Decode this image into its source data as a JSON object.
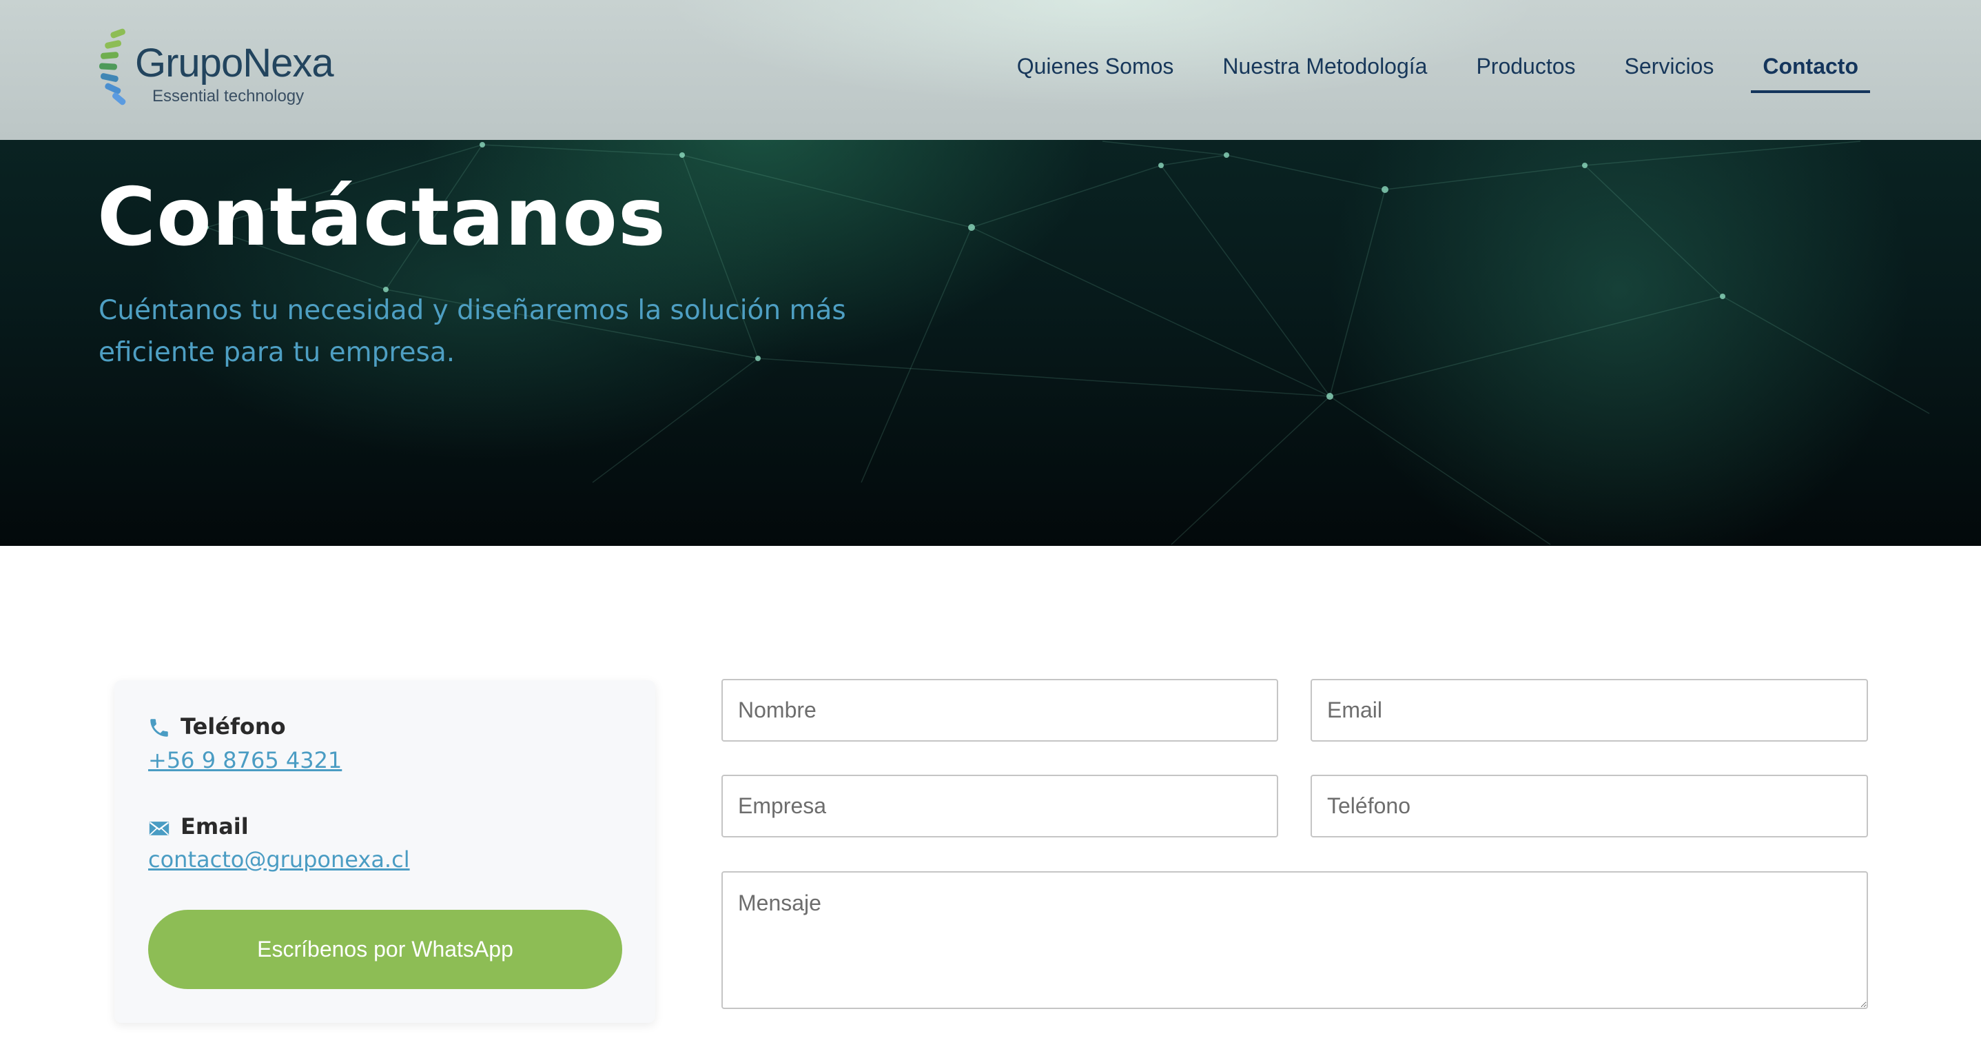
{
  "brand": {
    "name": "GrupoNexa",
    "tagline": "Essential technology"
  },
  "nav": {
    "items": [
      {
        "label": "Quienes Somos"
      },
      {
        "label": "Nuestra Metodología"
      },
      {
        "label": "Productos"
      },
      {
        "label": "Servicios"
      },
      {
        "label": "Contacto",
        "active": true
      }
    ]
  },
  "hero": {
    "title": "Contáctanos",
    "subtitle": "Cuéntanos tu necesidad y diseñaremos la solución más eficiente para tu empresa."
  },
  "contact": {
    "phone_label": "Teléfono",
    "phone_value": "+56 9 8765 4321",
    "email_label": "Email",
    "email_value": "contacto@gruponexa.cl",
    "whatsapp_label": "Escríbenos por WhatsApp"
  },
  "form": {
    "nombre_placeholder": "Nombre",
    "email_placeholder": "Email",
    "empresa_placeholder": "Empresa",
    "telefono_placeholder": "Teléfono",
    "mensaje_placeholder": "Mensaje"
  },
  "colors": {
    "accent_green": "#8dbd55",
    "link_blue": "#4a9cc3",
    "nav_blue": "#17375a"
  }
}
